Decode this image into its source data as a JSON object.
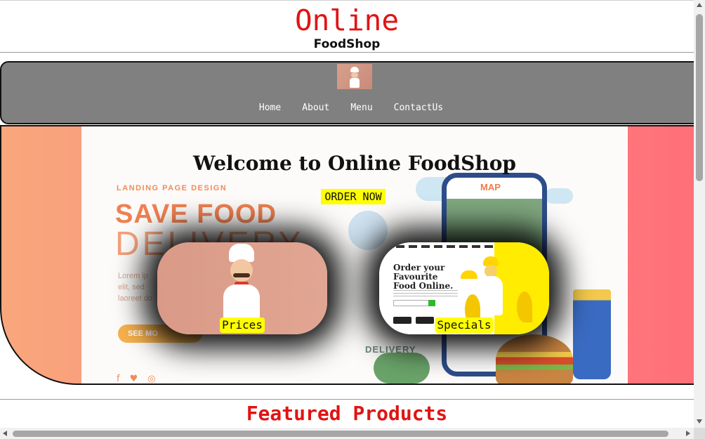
{
  "header": {
    "title": "Online",
    "subtitle": "FoodShop"
  },
  "nav": {
    "logo_icon": "chef-logo-icon",
    "links": [
      {
        "label": "Home"
      },
      {
        "label": "About"
      },
      {
        "label": "Menu"
      },
      {
        "label": "ContactUs"
      }
    ]
  },
  "hero": {
    "title": "Welcome to Online FoodShop",
    "order_button": "ORDER NOW",
    "background_card": {
      "tag": "LANDING PAGE DESIGN",
      "headline_1": "SAVE FOOD",
      "headline_2": "DELIVERY",
      "lorem": "Lorem ip",
      "lorem_2": "elit, sed",
      "lorem_3": "laoreet do",
      "see_more": "SEE MO",
      "map_label": "MAP",
      "delivery_label": "DELIVERY"
    },
    "promos": [
      {
        "label": "Prices"
      },
      {
        "label": "Specials",
        "inner_title": "Order your Favourite Food Online."
      }
    ]
  },
  "featured": {
    "title": "Featured Products"
  },
  "colors": {
    "title_red": "#e01414",
    "nav_gray": "#808080",
    "button_yellow": "#ffff00",
    "hero_gradient_left": "#f9a77c",
    "hero_gradient_right": "#ff6e78"
  }
}
